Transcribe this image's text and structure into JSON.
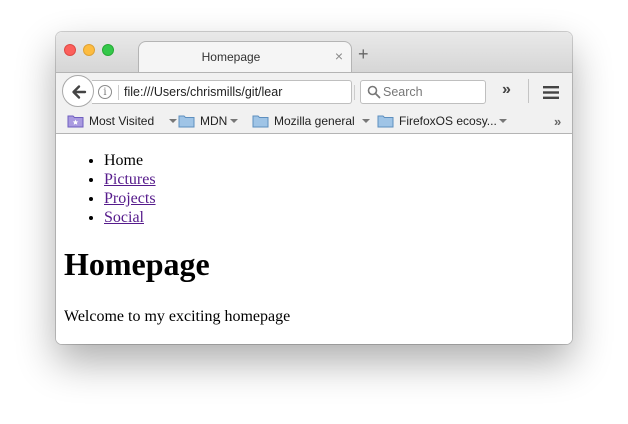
{
  "window": {
    "tab_title": "Homepage",
    "tab_close": "×",
    "new_tab": "+"
  },
  "navbar": {
    "url": "file:///Users/chrismills/git/lear",
    "search_placeholder": "Search",
    "overflow": "»"
  },
  "bookmarks": {
    "items": [
      {
        "label": "Most Visited",
        "icon": "star-folder-icon"
      },
      {
        "label": "MDN",
        "icon": "folder-icon"
      },
      {
        "label": "Mozilla general",
        "icon": "folder-icon"
      },
      {
        "label": "FirefoxOS ecosy...",
        "icon": "folder-icon"
      }
    ],
    "overflow": "»"
  },
  "page": {
    "nav": [
      "Home",
      "Pictures",
      "Projects",
      "Social"
    ],
    "heading": "Homepage",
    "paragraph": "Welcome to my exciting homepage"
  },
  "colors": {
    "link_visited": "#551a8b",
    "close_button": "#fc605c",
    "minimize_button": "#fdbc40",
    "maximize_button": "#34c84a"
  }
}
